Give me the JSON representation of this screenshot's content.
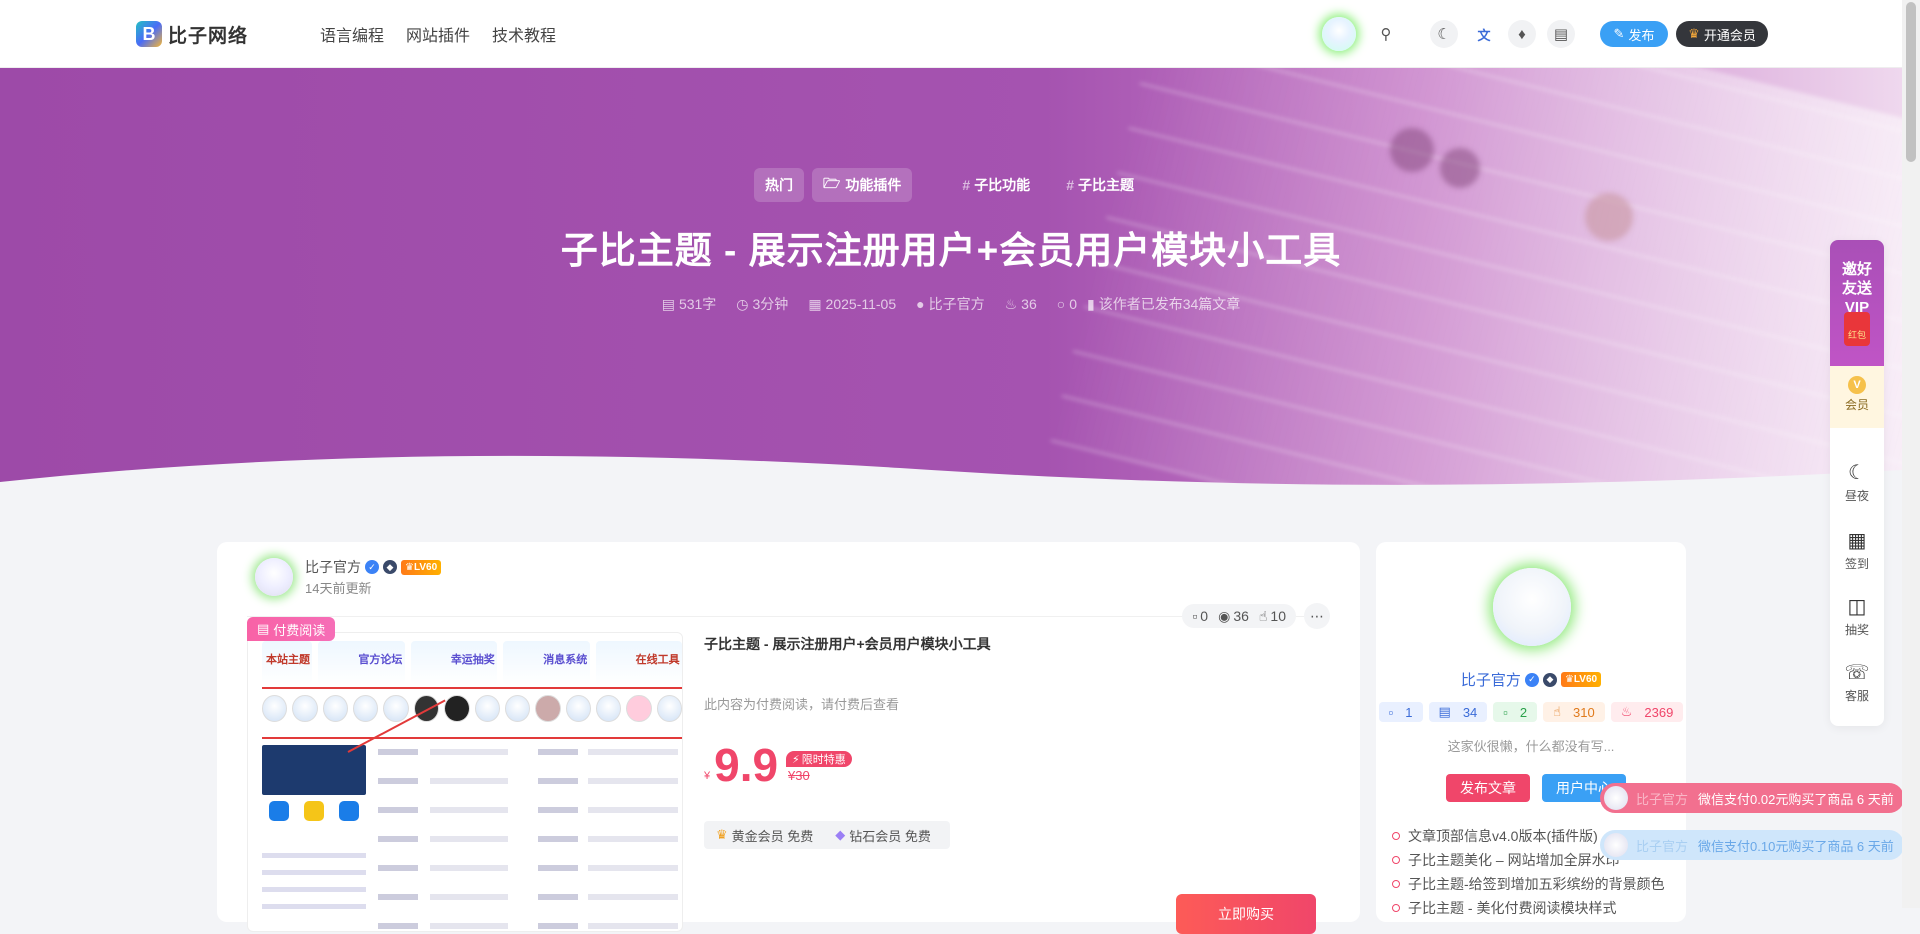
{
  "header": {
    "logo_text": "比子网络",
    "nav": [
      "语言编程",
      "网站插件",
      "技术教程"
    ],
    "publish_label": "发布",
    "vip_label": "开通会员"
  },
  "hero": {
    "tags": [
      "热门",
      "功能插件"
    ],
    "topics": [
      "子比功能",
      "子比主题"
    ],
    "title": "子比主题 - 展示注册用户+会员用户模块小工具",
    "meta": {
      "words": "531字",
      "read_time": "3分钟",
      "date": "2025-11-05",
      "author": "比子官方",
      "heat": "36",
      "comments": "0",
      "author_posts": "该作者已发布34篇文章"
    }
  },
  "post": {
    "author": "比子官方",
    "level": "LV60",
    "updated": "14天前更新",
    "stats": {
      "comments": "0",
      "views": "36",
      "likes": "10"
    },
    "paid_tag": "付费阅读",
    "thumb_tabs": [
      "本站主题",
      "官方论坛",
      "幸运抽奖",
      "消息系统",
      "在线工具"
    ],
    "card_title": "子比主题 - 展示注册用户+会员用户模块小工具",
    "desc": "此内容为付费阅读，请付费后查看",
    "currency": "¥",
    "price": "9.9",
    "limit_label": "限时特惠",
    "original_price": "¥30",
    "member_gold": "黄金会员 免费",
    "member_diamond": "钻石会员 免费",
    "buy_label": "立即购买"
  },
  "sidebar": {
    "name": "比子官方",
    "level": "LV60",
    "stats": [
      "1",
      "34",
      "2",
      "310",
      "2369"
    ],
    "bio": "这家伙很懒，什么都没有写...",
    "btn_publish": "发布文章",
    "btn_center": "用户中心",
    "list": [
      "文章顶部信息v4.0版本(插件版)",
      "子比主题美化 – 网站增加全屏水印",
      "子比主题-给签到增加五彩缤纷的背景颜色",
      "子比主题 - 美化付费阅读模块样式"
    ]
  },
  "float": {
    "invite": "邀好友送VIP",
    "red_envelope": "红包",
    "vip": "会员",
    "night": "昼夜",
    "checkin": "签到",
    "lottery": "抽奖",
    "service": "客服"
  },
  "toasts": [
    {
      "name": "比子官方",
      "text": "微信支付0.02元购买了商品 6 天前"
    },
    {
      "name": "比子官方",
      "text": "微信支付0.10元购买了商品 6 天前"
    }
  ],
  "colors": {
    "accent": "#3aa0f5",
    "hero": "#a553b0",
    "price": "#f0466a"
  }
}
